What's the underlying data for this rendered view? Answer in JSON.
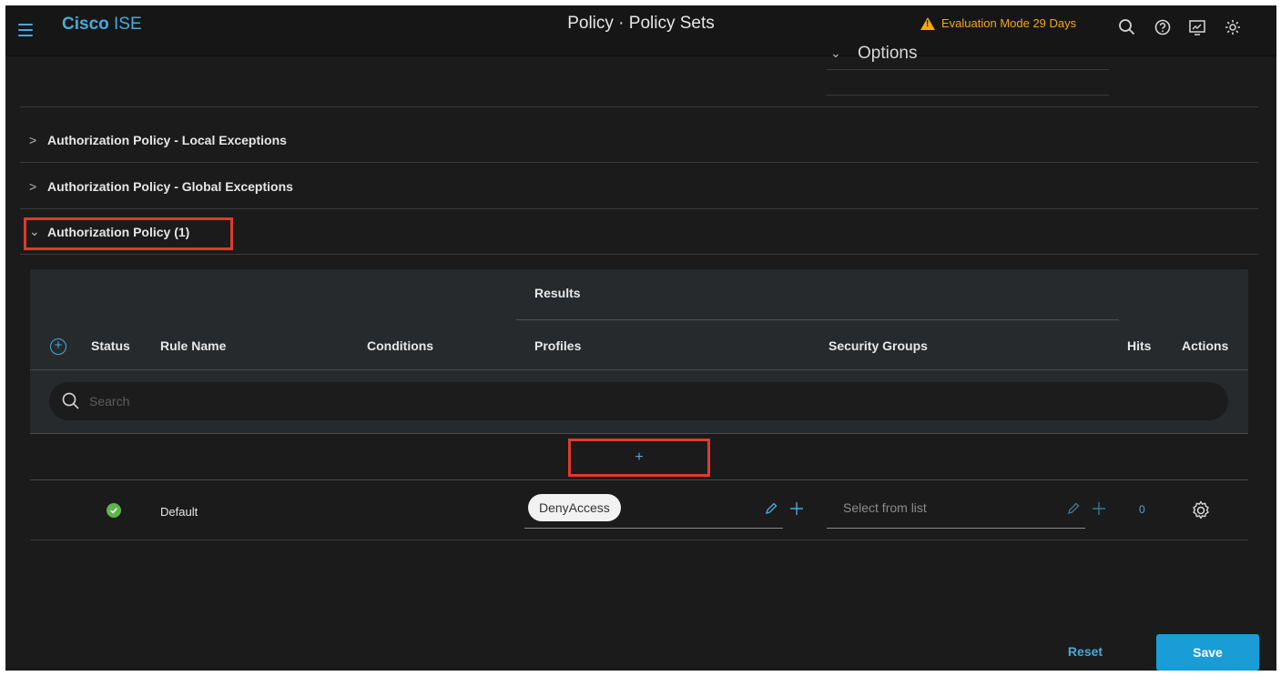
{
  "header": {
    "brand_bold": "Cisco",
    "brand_rest": " ISE",
    "title": "Policy · Policy Sets",
    "eval_mode": "Evaluation Mode 29 Days",
    "icons": [
      "menu-icon",
      "warning-icon",
      "search-icon",
      "help-icon",
      "dashboard-icon",
      "gear-icon"
    ]
  },
  "options": {
    "label": "Options"
  },
  "sections": [
    {
      "label": "Authorization Policy - Local Exceptions",
      "expanded": false
    },
    {
      "label": "Authorization Policy - Global Exceptions",
      "expanded": false
    },
    {
      "label": "Authorization Policy (1)",
      "expanded": true
    }
  ],
  "table": {
    "group_header": "Results",
    "columns": {
      "status": "Status",
      "rule_name": "Rule Name",
      "conditions": "Conditions",
      "profiles": "Profiles",
      "security_groups": "Security Groups",
      "hits": "Hits",
      "actions": "Actions"
    },
    "search_placeholder": "Search",
    "add_row_label": "+",
    "rows": [
      {
        "status": "enabled",
        "rule_name": "Default",
        "profile": "DenyAccess",
        "security_group_placeholder": "Select from list",
        "hits": "0"
      }
    ]
  },
  "footer": {
    "reset_label": "Reset",
    "save_label": "Save"
  },
  "colors": {
    "accent": "#49a9d9",
    "warning": "#f3a81a",
    "highlight": "#e03a2b",
    "save": "#1a9cd6",
    "status_ok": "#5fb54c"
  }
}
